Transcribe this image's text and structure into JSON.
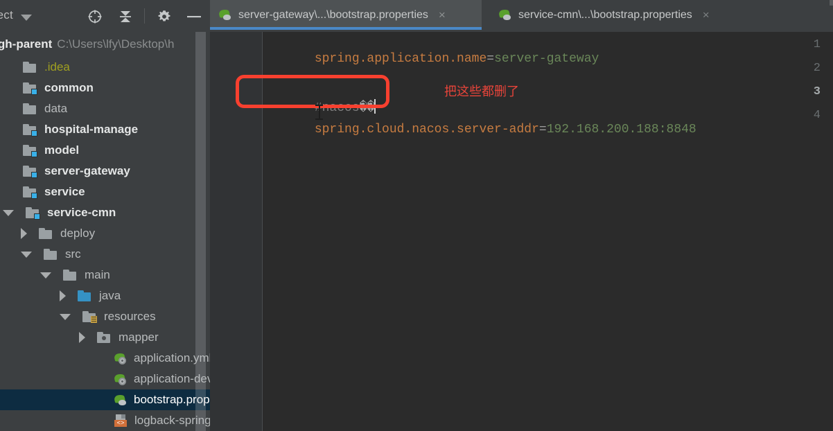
{
  "toolbar": {
    "project_label": "oject",
    "icons": [
      {
        "name": "locate-in-tree-icon",
        "glyph": "target"
      },
      {
        "name": "collapse-all-icon",
        "glyph": "collapse"
      },
      {
        "name": "settings-gear-icon",
        "glyph": "gear"
      },
      {
        "name": "hide-panel-icon",
        "glyph": "minus"
      }
    ]
  },
  "tabs": [
    {
      "label": "server-gateway\\...\\bootstrap.properties",
      "icon": "spring-boot-leaf-icon",
      "close": "×",
      "active": true
    },
    {
      "label": "service-cmn\\...\\bootstrap.properties",
      "icon": "spring-boot-leaf-icon",
      "close": "×",
      "active": false
    }
  ],
  "sidebar": {
    "root": {
      "name": "yygh-parent",
      "path": "C:\\Users\\lfy\\Desktop\\h"
    },
    "items": [
      {
        "label": ".idea",
        "indent": 0,
        "twisty": "none",
        "icon": "folder",
        "style": "yellow"
      },
      {
        "label": "common",
        "indent": 0,
        "twisty": "none",
        "icon": "folder-module",
        "style": "bold"
      },
      {
        "label": "data",
        "indent": 0,
        "twisty": "none",
        "icon": "folder",
        "style": "dim"
      },
      {
        "label": "hospital-manage",
        "indent": 0,
        "twisty": "none",
        "icon": "folder-module",
        "style": "bold"
      },
      {
        "label": "model",
        "indent": 0,
        "twisty": "none",
        "icon": "folder-module",
        "style": "bold"
      },
      {
        "label": "server-gateway",
        "indent": 0,
        "twisty": "none",
        "icon": "folder-module",
        "style": "bold"
      },
      {
        "label": "service",
        "indent": 0,
        "twisty": "none",
        "icon": "folder-module",
        "style": "bold"
      },
      {
        "label": "service-cmn",
        "indent": 1,
        "twisty": "down",
        "icon": "folder-module",
        "style": "bold"
      },
      {
        "label": "deploy",
        "indent": 2,
        "twisty": "right",
        "icon": "folder",
        "style": "dim"
      },
      {
        "label": "src",
        "indent": 2,
        "twisty": "down",
        "icon": "folder",
        "style": "dim"
      },
      {
        "label": "main",
        "indent": 3,
        "twisty": "down",
        "icon": "folder",
        "style": "dim"
      },
      {
        "label": "java",
        "indent": 4,
        "twisty": "right",
        "icon": "folder-source",
        "style": "dim"
      },
      {
        "label": "resources",
        "indent": 4,
        "twisty": "down",
        "icon": "folder-resources",
        "style": "dim"
      },
      {
        "label": "mapper",
        "indent": 5,
        "twisty": "right",
        "icon": "folder-package",
        "style": "dim"
      },
      {
        "label": "application.yml",
        "indent": 6,
        "twisty": "none",
        "icon": "spring-yaml",
        "style": "dim"
      },
      {
        "label": "application-dev",
        "indent": 6,
        "twisty": "none",
        "icon": "spring-yaml",
        "style": "dim"
      },
      {
        "label": "bootstrap.properties",
        "indent": 6,
        "twisty": "none",
        "icon": "spring-leaf",
        "style": "selected"
      },
      {
        "label": "logback-spring.",
        "indent": 6,
        "twisty": "none",
        "icon": "xml-file",
        "style": "dim"
      }
    ]
  },
  "editor": {
    "line_numbers": [
      "1",
      "2",
      "3",
      "4"
    ],
    "current_line": "3",
    "lines": [
      {
        "n": "1",
        "segments": [
          {
            "t": "spring.application.name",
            "c": "k"
          },
          {
            "t": "=",
            "c": "eq"
          },
          {
            "t": "server-gateway",
            "c": "v"
          }
        ]
      },
      {
        "n": "2",
        "segments": []
      },
      {
        "n": "3",
        "segments": [
          {
            "t": "#nacos",
            "c": "cmt"
          },
          {
            "t": "��",
            "c": "mojibake"
          }
        ]
      },
      {
        "n": "4",
        "segments": [
          {
            "t": "spring.cloud.nacos.server-addr",
            "c": "k"
          },
          {
            "t": "=",
            "c": "eq"
          },
          {
            "t": "192.168.200.188:8848",
            "c": "v"
          }
        ]
      }
    ]
  },
  "annotation": {
    "text": "把这些都删了",
    "color": "#e8443a",
    "box_color": "#f8402f"
  }
}
